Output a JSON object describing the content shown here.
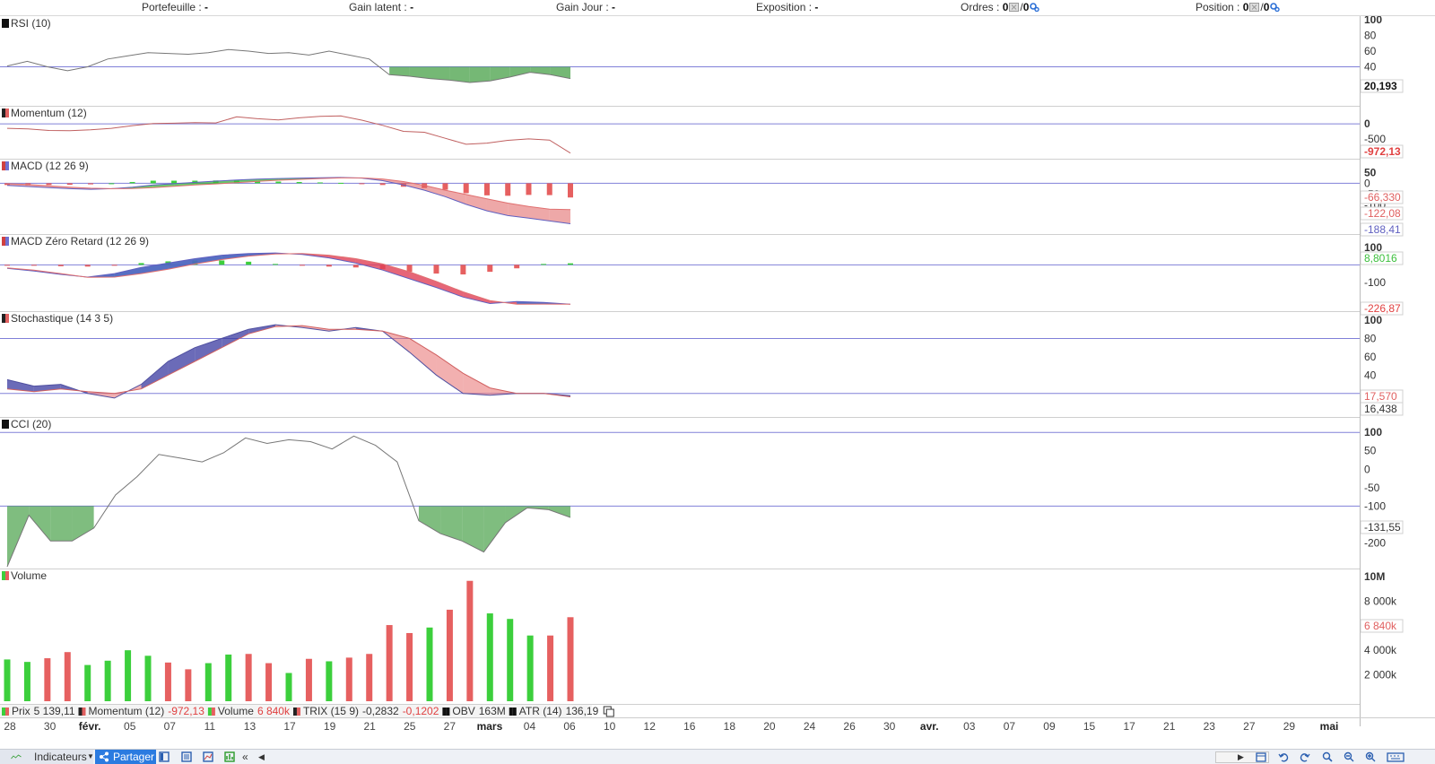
{
  "topbar": {
    "portefeuille": "Portefeuille :",
    "portefeuille_val": "-",
    "gain_latent": "Gain latent :",
    "gain_latent_val": "-",
    "gain_jour": "Gain Jour :",
    "gain_jour_val": "-",
    "exposition": "Exposition :",
    "exposition_val": "-",
    "ordres": "Ordres :",
    "ordres_a": "0",
    "ordres_b": "0",
    "position": "Position :",
    "position_a": "0",
    "position_b": "0",
    "slash": "/"
  },
  "colors": {
    "green": "#3ccf3c",
    "red": "#e66060",
    "blue": "#4a4ab0",
    "refline": "#8080d8",
    "line": "#777777"
  },
  "date_labels": [
    "28",
    "30",
    "févr.",
    "05",
    "07",
    "11",
    "13",
    "17",
    "19",
    "21",
    "25",
    "27",
    "mars",
    "04",
    "06",
    "10",
    "12",
    "16",
    "18",
    "20",
    "24",
    "26",
    "30",
    "avr.",
    "03",
    "07",
    "09",
    "15",
    "17",
    "21",
    "23",
    "27",
    "29",
    "mai"
  ],
  "chart_data": [
    {
      "type": "line",
      "name": "RSI (10)",
      "ylim": [
        20,
        100
      ],
      "yticks": [
        "100",
        "80",
        "60",
        "40"
      ],
      "ref": [
        40
      ],
      "last_labels": [
        "20,193"
      ],
      "values": [
        41,
        47,
        40,
        35,
        40,
        50,
        54,
        58,
        57,
        56,
        58,
        62,
        60,
        57,
        58,
        55,
        60,
        55,
        50,
        30,
        28,
        25,
        23,
        20,
        22,
        27,
        33,
        30,
        25
      ]
    },
    {
      "type": "line",
      "name": "Momentum (12)",
      "ylim": [
        -1100,
        300
      ],
      "yticks": [
        "0",
        "-500"
      ],
      "ref": [
        0
      ],
      "last_labels": [
        "-972,13"
      ],
      "values": [
        -150,
        -170,
        -220,
        -230,
        -200,
        -150,
        -60,
        10,
        20,
        40,
        30,
        230,
        170,
        130,
        200,
        250,
        260,
        120,
        -50,
        -250,
        -280,
        -480,
        -680,
        -640,
        -550,
        -500,
        -540,
        -972
      ]
    },
    {
      "type": "macd",
      "name": "MACD (12 26 9)",
      "ylim": [
        -215,
        60
      ],
      "yticks": [
        "50",
        "0",
        "-50",
        "-100",
        "-150"
      ],
      "ref": [
        0
      ],
      "last_labels": [
        "-66,330",
        "-122,08",
        "-188,41"
      ],
      "macd": [
        -10,
        -15,
        -20,
        -25,
        -28,
        -25,
        -18,
        -8,
        -2,
        4,
        10,
        15,
        19,
        22,
        24,
        26,
        27,
        24,
        12,
        -8,
        -32,
        -62,
        -98,
        -128,
        -150,
        -162,
        -175,
        -188
      ],
      "signal": [
        -2,
        -6,
        -12,
        -18,
        -23,
        -25,
        -24,
        -20,
        -14,
        -8,
        -3,
        3,
        9,
        14,
        18,
        22,
        25,
        25,
        20,
        8,
        -10,
        -32,
        -52,
        -72,
        -92,
        -108,
        -120,
        -122
      ],
      "hist": [
        -8,
        -9,
        -8,
        -7,
        -5,
        0,
        6,
        12,
        12,
        12,
        13,
        12,
        10,
        8,
        6,
        4,
        2,
        -1,
        -8,
        -16,
        -22,
        -30,
        -46,
        -56,
        -58,
        -54,
        -55,
        -66
      ]
    },
    {
      "type": "macd",
      "name": "MACD Zéro Retard (12 26 9)",
      "ylim": [
        -245,
        120
      ],
      "yticks": [
        "100",
        "-100"
      ],
      "ref": [
        0
      ],
      "last_labels": [
        "8,8016",
        "-226,87"
      ],
      "macd": [
        -20,
        -35,
        -55,
        -70,
        -50,
        -15,
        10,
        35,
        55,
        65,
        68,
        60,
        40,
        10,
        -30,
        -80,
        -130,
        -185,
        -222,
        -210,
        -215,
        -226
      ],
      "signal": [
        -18,
        -30,
        -50,
        -72,
        -70,
        -50,
        -25,
        5,
        30,
        50,
        62,
        65,
        55,
        35,
        5,
        -40,
        -95,
        -155,
        -205,
        -226,
        -225,
        -226
      ],
      "hist": [
        -4,
        -5,
        -8,
        -10,
        -5,
        10,
        20,
        25,
        25,
        18,
        5,
        -5,
        -10,
        -15,
        -25,
        -40,
        -50,
        -55,
        -40,
        -20,
        5,
        8.8
      ]
    },
    {
      "type": "stoch",
      "name": "Stochastique (14 3 5)",
      "ylim": [
        10,
        100
      ],
      "yticks": [
        "100",
        "80",
        "60",
        "40",
        "20"
      ],
      "ref": [
        80,
        20
      ],
      "last_labels": [
        "17,570",
        "16,438"
      ],
      "k": [
        35,
        28,
        30,
        20,
        15,
        30,
        55,
        70,
        80,
        90,
        95,
        92,
        88,
        92,
        88,
        65,
        40,
        20,
        18,
        20,
        20,
        17.6
      ],
      "d": [
        25,
        22,
        25,
        22,
        20,
        25,
        40,
        55,
        70,
        85,
        93,
        94,
        90,
        90,
        88,
        80,
        62,
        42,
        26,
        20,
        20,
        16.4
      ]
    },
    {
      "type": "cci",
      "name": "CCI (20)",
      "ylim": [
        -260,
        120
      ],
      "yticks": [
        "100",
        "50",
        "0",
        "-50",
        "-100",
        "-150",
        "-200"
      ],
      "ref": [
        100,
        -100
      ],
      "last_labels": [
        "-131,55"
      ],
      "values": [
        -280,
        -125,
        -195,
        -195,
        -160,
        -70,
        -20,
        40,
        30,
        20,
        45,
        85,
        70,
        80,
        75,
        55,
        90,
        65,
        20,
        -140,
        -175,
        -195,
        -225,
        -145,
        -105,
        -110,
        -131
      ]
    },
    {
      "type": "bar",
      "name": "Volume",
      "ylim": [
        0,
        10000
      ],
      "yticks": [
        "10M",
        "8 000k",
        "6 000k",
        "4 000k",
        "2 000k"
      ],
      "last_labels": [
        "6 840k"
      ],
      "values": [
        3400,
        3200,
        3500,
        4000,
        2950,
        3300,
        4150,
        3700,
        3150,
        2600,
        3100,
        3800,
        3850,
        3100,
        2300,
        3450,
        3250,
        3550,
        3850,
        6200,
        5550,
        6000,
        7450,
        9800,
        7150,
        6700,
        5350,
        5350,
        6840
      ],
      "up": [
        true,
        true,
        false,
        false,
        true,
        true,
        true,
        true,
        false,
        false,
        true,
        true,
        false,
        false,
        true,
        false,
        true,
        false,
        false,
        false,
        false,
        true,
        false,
        false,
        true,
        true,
        true,
        false,
        false
      ]
    }
  ],
  "legend": [
    {
      "name": "Prix",
      "value": "5 139,11"
    },
    {
      "name": "Momentum (12)",
      "value": "-972,13"
    },
    {
      "name": "Volume",
      "value": "6 840k"
    },
    {
      "name": "TRIX (15 9)",
      "value": "-0,2832",
      "value2": "-0,1202"
    },
    {
      "name": "OBV",
      "value": "163M"
    },
    {
      "name": "ATR (14)",
      "value": "136,19"
    }
  ],
  "bottombar": {
    "indicateurs": "Indicateurs",
    "partager": "Partager",
    "collapse": "«"
  }
}
